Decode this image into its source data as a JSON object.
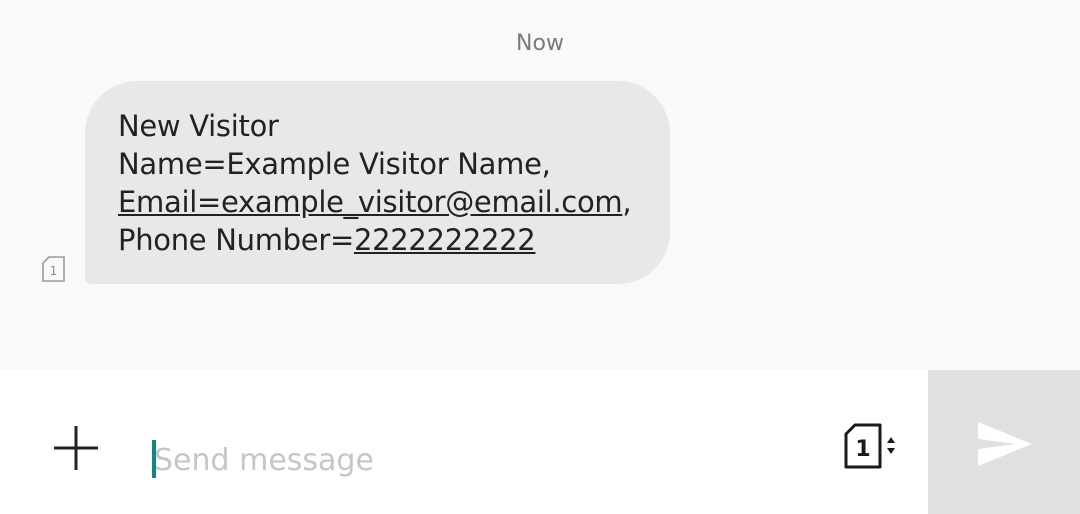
{
  "conversation": {
    "timestamp": "Now",
    "message": {
      "line1": "New Visitor",
      "line2": "Name=Example Visitor Name,",
      "email_link": "Email=example_visitor@email.com",
      "email_suffix": ",",
      "phone_prefix": "Phone Number=",
      "phone_link": "2222222222",
      "sim_slot": "1"
    }
  },
  "composer": {
    "placeholder": "Send message",
    "value": "",
    "sim_slot": "1"
  },
  "icons": {
    "attach": "plus-icon",
    "sim": "sim-card-icon",
    "send": "send-icon"
  },
  "colors": {
    "background": "#f9f9f9",
    "bubble": "#e8e8e8",
    "caret": "#11897c",
    "send_button_bg": "#e0e0e0"
  }
}
